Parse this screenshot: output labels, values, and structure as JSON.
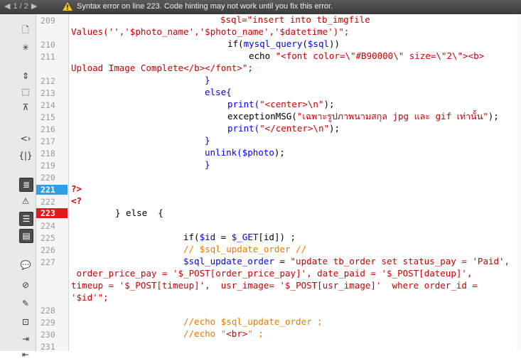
{
  "status_bar": {
    "page_indicator": "1 / 2",
    "message": "Syntax error on line 223.  Code hinting may not work until you fix this error."
  },
  "toolbar": {
    "icons": [
      "open-documents-icon",
      "asterisk-icon",
      "expand-tag-icon",
      "select-parent-icon",
      "collapse-icon",
      "wrap-tag-icon",
      "balance-braces-icon",
      "line-numbers-icon",
      "highlight-invalid-icon",
      "syntax-coloring-icon",
      "word-wrap-icon",
      "comment-icon",
      "remove-comment-icon",
      "wrap-tag-icon",
      "format-icon",
      "indent-icon",
      "outdent-icon"
    ]
  },
  "gutter": {
    "lines": [
      "209",
      "210",
      "211",
      "212",
      "213",
      "214",
      "215",
      "216",
      "217",
      "218",
      "219",
      "220",
      "221",
      "222",
      "223",
      "224",
      "225",
      "226",
      "227",
      "228",
      "229",
      "230",
      "231"
    ]
  },
  "code": {
    "l209a": "$sql=\"insert into tb_imgfile",
    "l209b_1": "Values('','",
    "l209b_2": "$photo_name",
    "l209b_3": "','",
    "l209b_4": "$photo_name",
    "l209b_5": "','",
    "l209b_6": "$datetime",
    "l209b_7": "')\";",
    "l210_1": "if(",
    "l210_2": "mysql_query",
    "l210_3": "(",
    "l210_4": "$sql",
    "l210_5": "))",
    "l211_1": "echo ",
    "l211_2": "\"<font color=\\\"#B90000\\\" size=\\\"2\\\"><b>",
    "l211b": "Upload Image Complete</b></font>\";",
    "l212": "}",
    "l213": "else{",
    "l214_1": "print(",
    "l214_2": "\"<center>\\n\"",
    "l214_3": ");",
    "l215_1": "exceptionMSG(",
    "l215_2": "\"เฉพาะรูปภาพนามสกุล jpg และ gif เท่านั้น\"",
    "l215_3": ");",
    "l216_1": "print(",
    "l216_2": "\"</center>\\n\"",
    "l216_3": ");",
    "l217": "}",
    "l218_1": "unlink(",
    "l218_2": "$photo",
    "l218_3": ");",
    "l219": "}",
    "l221": "?>",
    "l222": "<?",
    "l223": "} else  {",
    "l225_1": "if(",
    "l225_2": "$id",
    "l225_3": " = ",
    "l225_4": "$_GET",
    "l225_5": "[id]) ;",
    "l226": "// $sql_update_order //",
    "l227_1": "$sql_update_order",
    "l227_2": " = ",
    "l227_3": "\"update tb_order set status_pay = 'Paid',",
    "l227b": " order_price_pay = '$_POST[order_price_pay]', date_paid = '$_POST[dateup]',",
    "l227c": "timeup = '$_POST[timeup]',  usr_image= '$_POST[usr_image]'  where order_id =",
    "l227d": "'$id'\";",
    "l229": "//echo $sql_update_order ;",
    "l230_1": "//echo \"",
    "l230_2": "<br>",
    "l230_3": "\" ;"
  }
}
